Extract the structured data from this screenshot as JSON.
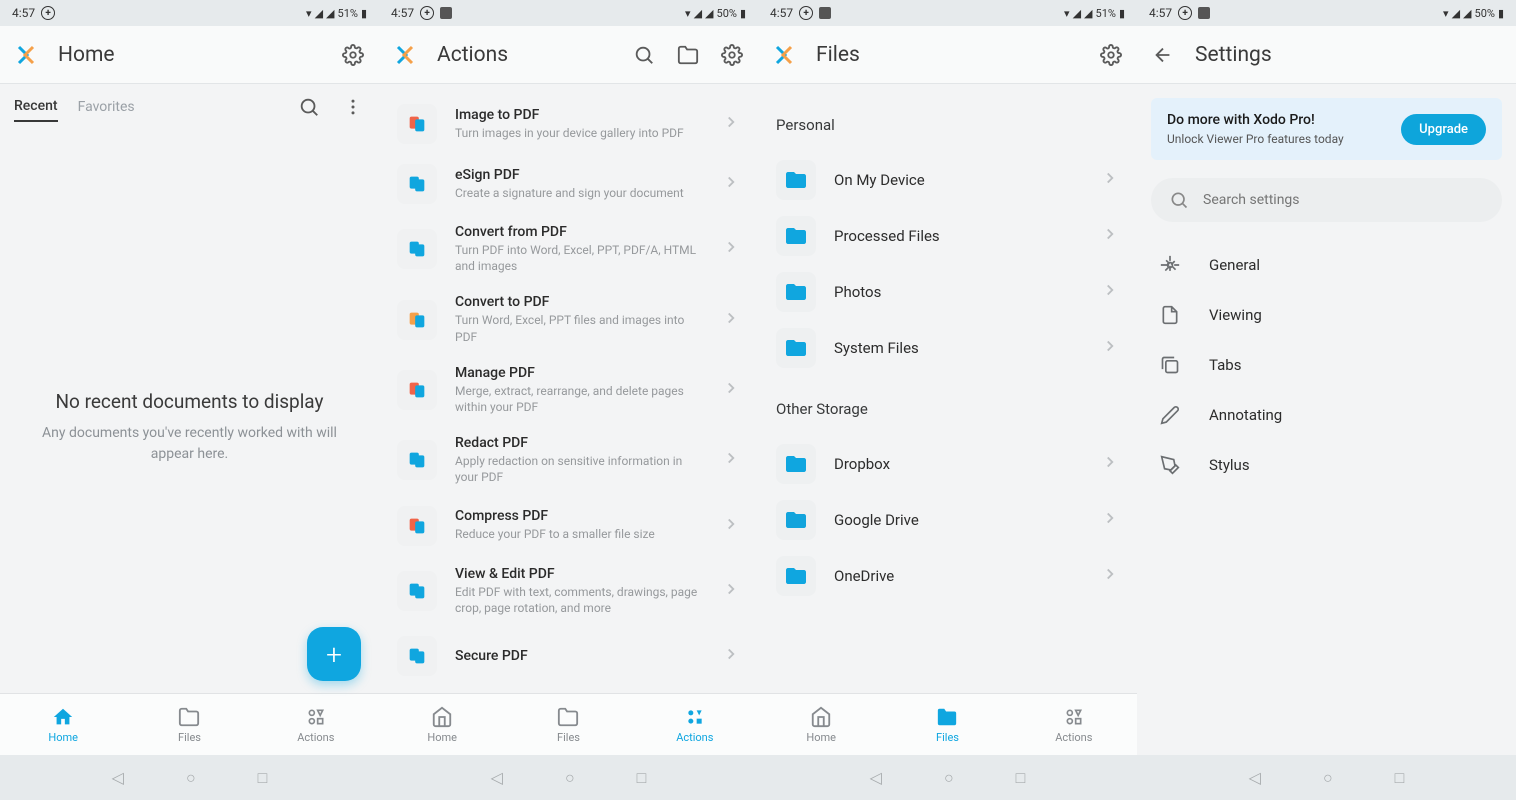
{
  "status": {
    "time": "4:57",
    "battery_a": "51%",
    "battery_b": "50%"
  },
  "titles": {
    "home": "Home",
    "actions": "Actions",
    "files": "Files",
    "settings": "Settings"
  },
  "home": {
    "tab_recent": "Recent",
    "tab_favorites": "Favorites",
    "empty_title": "No recent documents to display",
    "empty_sub": "Any documents you've recently worked with will appear here."
  },
  "actions": [
    {
      "title": "Image to PDF",
      "sub": "Turn images in your device gallery into PDF"
    },
    {
      "title": "eSign PDF",
      "sub": "Create a signature and sign your document"
    },
    {
      "title": "Convert from PDF",
      "sub": "Turn PDF into Word, Excel, PPT, PDF/A, HTML and images"
    },
    {
      "title": "Convert to PDF",
      "sub": "Turn Word, Excel, PPT files and images into PDF"
    },
    {
      "title": "Manage PDF",
      "sub": "Merge, extract, rearrange, and delete pages within your PDF"
    },
    {
      "title": "Redact PDF",
      "sub": "Apply redaction on sensitive information in your PDF"
    },
    {
      "title": "Compress PDF",
      "sub": "Reduce your PDF to a smaller file size"
    },
    {
      "title": "View & Edit PDF",
      "sub": "Edit PDF with text, comments, drawings, page crop, page rotation, and more"
    },
    {
      "title": "Secure PDF",
      "sub": ""
    }
  ],
  "files": {
    "section_personal": "Personal",
    "section_other": "Other Storage",
    "personal": [
      "On My Device",
      "Processed Files",
      "Photos",
      "System Files"
    ],
    "other": [
      "Dropbox",
      "Google Drive",
      "OneDrive"
    ]
  },
  "settings": {
    "promo_title": "Do more with Xodo Pro!",
    "promo_sub": "Unlock Viewer Pro features today",
    "upgrade": "Upgrade",
    "search_placeholder": "Search settings",
    "items": [
      "General",
      "Viewing",
      "Tabs",
      "Annotating",
      "Stylus"
    ]
  },
  "nav": {
    "home": "Home",
    "files": "Files",
    "actions": "Actions"
  }
}
